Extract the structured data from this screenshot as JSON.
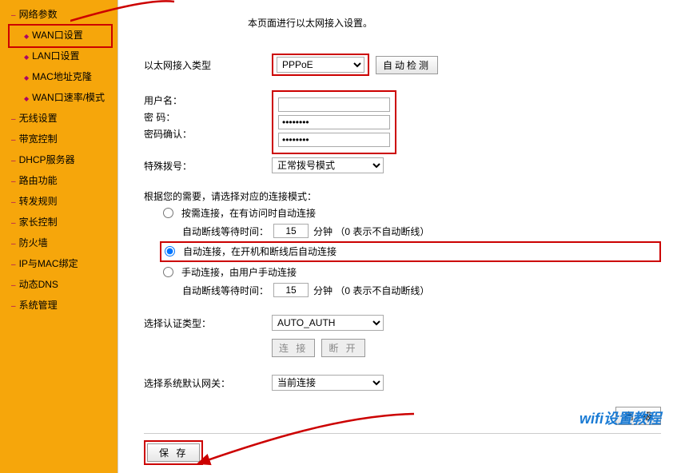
{
  "sidebar": {
    "items": [
      {
        "kind": "e",
        "label": "网络参数"
      },
      {
        "kind": "sub",
        "label": "WAN口设置",
        "selected": true
      },
      {
        "kind": "sub",
        "label": "LAN口设置"
      },
      {
        "kind": "sub",
        "label": "MAC地址克隆"
      },
      {
        "kind": "sub",
        "label": "WAN口速率/模式"
      },
      {
        "kind": "e",
        "label": "无线设置"
      },
      {
        "kind": "e",
        "label": "带宽控制"
      },
      {
        "kind": "e",
        "label": "DHCP服务器"
      },
      {
        "kind": "e",
        "label": "路由功能"
      },
      {
        "kind": "e",
        "label": "转发规则"
      },
      {
        "kind": "e",
        "label": "家长控制"
      },
      {
        "kind": "e",
        "label": "防火墙"
      },
      {
        "kind": "e",
        "label": "IP与MAC绑定"
      },
      {
        "kind": "e",
        "label": "动态DNS"
      },
      {
        "kind": "e",
        "label": "系统管理"
      }
    ]
  },
  "main": {
    "intro": "本页面进行以太网接入设置。",
    "wan_type_label": "以太网接入类型",
    "wan_type_value": "PPPoE",
    "auto_detect_label": "自动检测",
    "user_label": "用户名：",
    "user_value": "",
    "pwd_label": "密 码：",
    "pwd_value": "********",
    "pwd_confirm_label": "密码确认：",
    "pwd_confirm_value": "********",
    "special_dial_label": "特殊拨号：",
    "special_dial_value": "正常拨号模式",
    "conn_intro": "根据您的需要，请选择对应的连接模式：",
    "mode_ondemand_label": "按需连接，在有访问时自动连接",
    "idle_wait_label": "自动断线等待时间：",
    "idle_wait_value": "15",
    "idle_wait_unit": "分钟 （0 表示不自动断线）",
    "mode_auto_label": "自动连接，在开机和断线后自动连接",
    "mode_manual_label": "手动连接，由用户手动连接",
    "auth_type_label": "选择认证类型：",
    "auth_type_value": "AUTO_AUTH",
    "connect_btn": "连 接",
    "disconnect_btn": "断 开",
    "default_gateway_label": "选择系统默认网关：",
    "default_gateway_value": "当前连接",
    "advanced_btn_label": "高 级",
    "save_btn_label": "保 存"
  },
  "watermark": "wifi设置教程"
}
